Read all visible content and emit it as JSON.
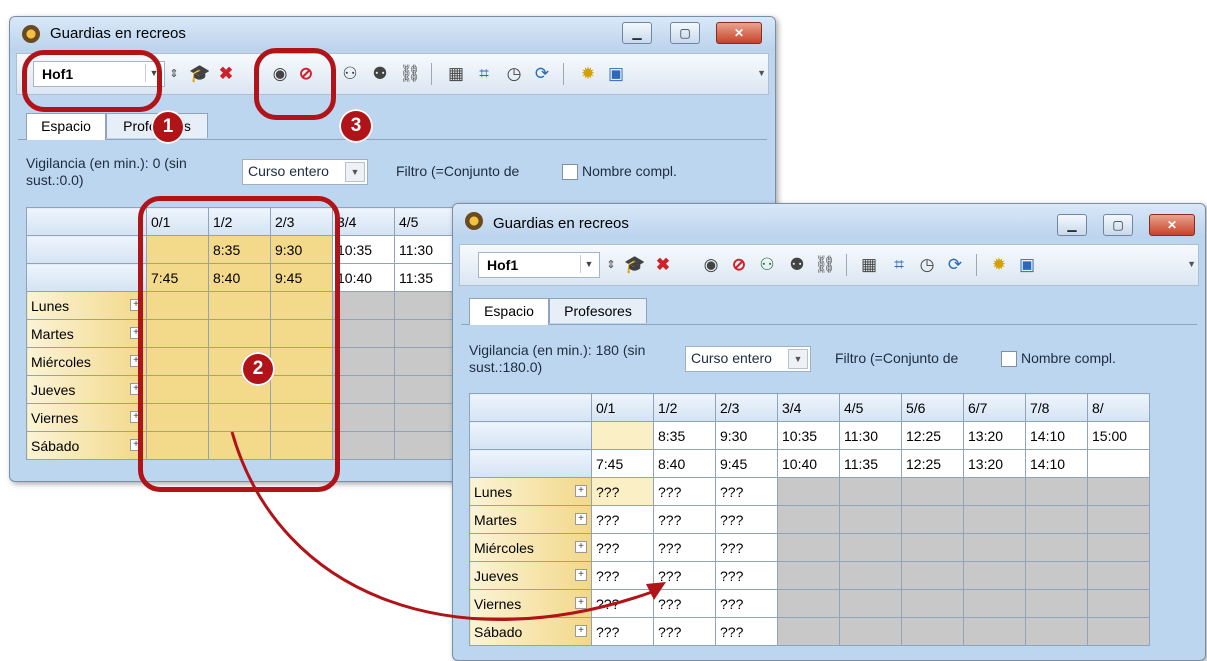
{
  "back_window": {
    "title": "Guardias en recreos",
    "class_value": "Hof1",
    "tabs": [
      "Espacio",
      "Profesores"
    ],
    "vigilancia": "Vigilancia (en min.): 0 (sin sust.:0.0)",
    "scope_value": "Curso entero",
    "filter_label": "Filtro (=Conjunto de",
    "fullname_label": "Nombre compl.",
    "grid": {
      "periods": [
        "0/1",
        "1/2",
        "2/3",
        "3/4",
        "4/5"
      ],
      "start_times": [
        "",
        "8:35",
        "9:30",
        "10:35",
        "11:30"
      ],
      "end_times": [
        "7:45",
        "8:40",
        "9:45",
        "10:40",
        "11:35"
      ],
      "days": [
        "Lunes",
        "Martes",
        "Miércoles",
        "Jueves",
        "Viernes",
        "Sábado"
      ]
    }
  },
  "front_window": {
    "title": "Guardias en recreos",
    "class_value": "Hof1",
    "tabs": [
      "Espacio",
      "Profesores"
    ],
    "vigilancia": "Vigilancia (en min.): 180 (sin sust.:180.0)",
    "scope_value": "Curso entero",
    "filter_label": "Filtro (=Conjunto de",
    "fullname_label": "Nombre compl.",
    "grid": {
      "periods": [
        "0/1",
        "1/2",
        "2/3",
        "3/4",
        "4/5",
        "5/6",
        "6/7",
        "7/8",
        "8/"
      ],
      "start_times": [
        "",
        "8:35",
        "9:30",
        "10:35",
        "11:30",
        "12:25",
        "13:20",
        "14:10",
        "15:00"
      ],
      "end_times": [
        "7:45",
        "8:40",
        "9:45",
        "10:40",
        "11:35",
        "12:25",
        "13:20",
        "14:10",
        ""
      ],
      "days": [
        "Lunes",
        "Martes",
        "Miércoles",
        "Jueves",
        "Viernes",
        "Sábado"
      ],
      "cell_text": "???"
    }
  },
  "annotations": {
    "badge1": "1",
    "badge2": "2",
    "badge3": "3"
  },
  "icons": {
    "toolbar": [
      "spin-icon",
      "graduation-cap-icon",
      "delete-x-icon",
      "eye-icon",
      "eye-hidden-icon",
      "people-icon",
      "people-swap-icon",
      "link-icon",
      "calculator-icon",
      "crop-icon",
      "clock-icon",
      "refresh-icon",
      "gear-icon",
      "window-search-icon"
    ]
  },
  "colors": {
    "accent_red": "#b01418",
    "titlebar": "#bdd6ef",
    "highlight_yellow": "#f3d98a"
  }
}
